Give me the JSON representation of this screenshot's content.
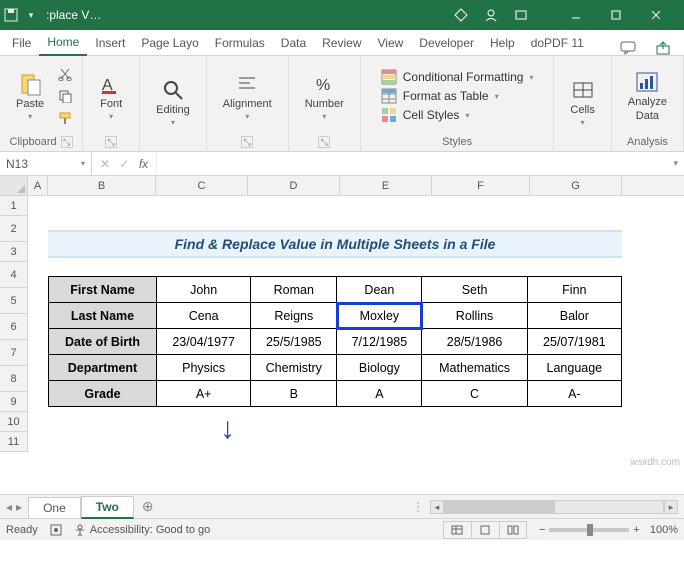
{
  "app": {
    "title": ":place V…"
  },
  "tabs": {
    "file": "File",
    "home": "Home",
    "insert": "Insert",
    "pagelayout": "Page Layo",
    "formulas": "Formulas",
    "data": "Data",
    "review": "Review",
    "view": "View",
    "developer": "Developer",
    "help": "Help",
    "dopdf": "doPDF 11"
  },
  "ribbon": {
    "clipboard": {
      "paste": "Paste",
      "label": "Clipboard"
    },
    "font": {
      "btn": "Font",
      "label": "Font"
    },
    "editing": {
      "btn": "Editing",
      "label": ""
    },
    "alignment": {
      "btn": "Alignment",
      "label": ""
    },
    "number": {
      "btn": "Number",
      "label": ""
    },
    "styles": {
      "cond": "Conditional Formatting",
      "table": "Format as Table",
      "cell": "Cell Styles",
      "label": "Styles"
    },
    "cells": {
      "btn": "Cells",
      "label": ""
    },
    "analysis": {
      "btn": "Analyze",
      "btn2": "Data",
      "label": "Analysis"
    }
  },
  "formulabar": {
    "name": "N13",
    "fx": "fx",
    "value": ""
  },
  "cols": {
    "A": "A",
    "B": "B",
    "C": "C",
    "D": "D",
    "E": "E",
    "F": "F",
    "G": "G"
  },
  "rows": [
    "1",
    "2",
    "3",
    "4",
    "5",
    "6",
    "7",
    "8",
    "9",
    "10",
    "11"
  ],
  "title": "Find & Replace Value in Multiple Sheets in a File",
  "table": {
    "rows": [
      {
        "h": "First Name",
        "c": [
          "John",
          "Roman",
          "Dean",
          "Seth",
          "Finn"
        ]
      },
      {
        "h": "Last Name",
        "c": [
          "Cena",
          "Reigns",
          "Moxley",
          "Rollins",
          "Balor"
        ]
      },
      {
        "h": "Date of Birth",
        "c": [
          "23/04/1977",
          "25/5/1985",
          "7/12/1985",
          "28/5/1986",
          "25/07/1981"
        ]
      },
      {
        "h": "Department",
        "c": [
          "Physics",
          "Chemistry",
          "Biology",
          "Mathematics",
          "Language"
        ]
      },
      {
        "h": "Grade",
        "c": [
          "A+",
          "B",
          "A",
          "C",
          "A-"
        ]
      }
    ],
    "selected": {
      "row": 1,
      "col": 2
    }
  },
  "sheets": {
    "one": "One",
    "two": "Two"
  },
  "status": {
    "ready": "Ready",
    "access": "Accessibility: Good to go",
    "zoom": "100%"
  },
  "watermark": "wsxdh.com"
}
